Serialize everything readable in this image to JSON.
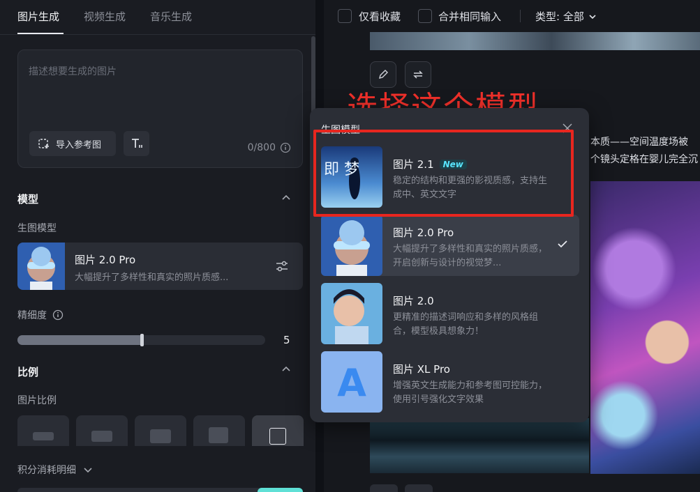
{
  "tabs": [
    "图片生成",
    "视频生成",
    "音乐生成"
  ],
  "prompt": {
    "placeholder": "描述想要生成的图片",
    "ref_button": "导入参考图",
    "counter": "0/800"
  },
  "model_section": {
    "title": "模型",
    "sub_label": "生图模型",
    "current": {
      "name": "图片 2.0 Pro",
      "desc": "大幅提升了多样性和真实的照片质感..."
    }
  },
  "detail": {
    "label": "精细度",
    "value": "5",
    "fraction": 0.5
  },
  "ratio_section": {
    "title": "比例",
    "sub_label": "图片比例",
    "selected_index": 4
  },
  "credits_label": "积分消耗明细",
  "filters": {
    "favorites": "仅看收藏",
    "merge": "合并相同输入",
    "type": "类型: 全部"
  },
  "annotation": "选择这个模型",
  "popup": {
    "title": "生图模型",
    "items": [
      {
        "name": "图片 2.1",
        "badge": "New",
        "desc": "稳定的结构和更强的影视质感，支持生成中、英文文字",
        "thumb_text": "即 梦",
        "selected": false
      },
      {
        "name": "图片 2.0 Pro",
        "badge": "",
        "desc": "大幅提升了多样性和真实的照片质感，开启创新与设计的视觉梦...",
        "selected": true
      },
      {
        "name": "图片 2.0",
        "badge": "",
        "desc": "更精准的描述词响应和多样的风格组合，模型极具想象力！",
        "selected": false
      },
      {
        "name": "图片 XL Pro",
        "badge": "",
        "desc": "增强英文生成能力和参考图可控能力，使用引号强化文字效果",
        "thumb_text": "A",
        "selected": false
      }
    ]
  },
  "right_texts": {
    "line1": "本质——空间温度场被",
    "line2": "个镜头定格在婴儿完全沉"
  },
  "colors": {
    "accent": "#5fe0d6",
    "annotation": "#f0302a",
    "new_badge": "#58e6ff"
  }
}
